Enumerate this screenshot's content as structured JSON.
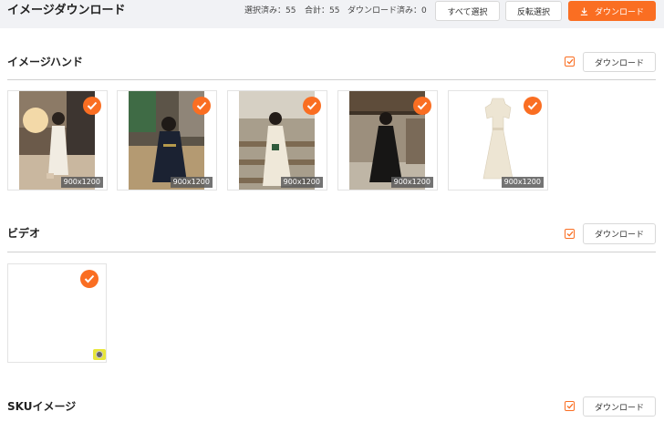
{
  "header": {
    "title": "イメージダウンロード",
    "selected": "選択済み：55",
    "total": "合計：55",
    "downloaded": "ダウンロード済み：0",
    "select_all": "すべて選択",
    "invert_select": "反転選択",
    "download": "ダウンロード"
  },
  "sections": {
    "images": {
      "title": "イメージハンド",
      "download": "ダウンロード",
      "checked": true,
      "items": [
        {
          "size": "900x1200",
          "scene": "cafe-white-dress"
        },
        {
          "size": "900x1200",
          "scene": "black-dress-seated"
        },
        {
          "size": "900x1200",
          "scene": "lace-dress-staircase"
        },
        {
          "size": "900x1200",
          "scene": "black-dress-courtyard"
        },
        {
          "size": "900x1200",
          "scene": "cream-dress-product"
        }
      ]
    },
    "video": {
      "title": "ビデオ",
      "download": "ダウンロード",
      "checked": true
    },
    "sku": {
      "title": "SKUイメージ",
      "download": "ダウンロード",
      "checked": true
    }
  },
  "colors": {
    "accent": "#fa6e22",
    "topbar": "#f1f2f5",
    "play_badge": "#e8e63a"
  }
}
